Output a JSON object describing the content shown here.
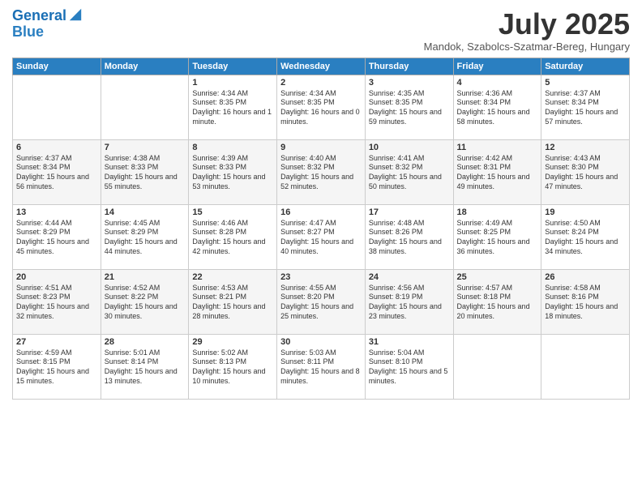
{
  "logo": {
    "line1": "General",
    "line2": "Blue"
  },
  "title": "July 2025",
  "location": "Mandok, Szabolcs-Szatmar-Bereg, Hungary",
  "weekdays": [
    "Sunday",
    "Monday",
    "Tuesday",
    "Wednesday",
    "Thursday",
    "Friday",
    "Saturday"
  ],
  "weeks": [
    [
      {
        "day": "",
        "sunrise": "",
        "sunset": "",
        "daylight": ""
      },
      {
        "day": "",
        "sunrise": "",
        "sunset": "",
        "daylight": ""
      },
      {
        "day": "1",
        "sunrise": "Sunrise: 4:34 AM",
        "sunset": "Sunset: 8:35 PM",
        "daylight": "Daylight: 16 hours and 1 minute."
      },
      {
        "day": "2",
        "sunrise": "Sunrise: 4:34 AM",
        "sunset": "Sunset: 8:35 PM",
        "daylight": "Daylight: 16 hours and 0 minutes."
      },
      {
        "day": "3",
        "sunrise": "Sunrise: 4:35 AM",
        "sunset": "Sunset: 8:35 PM",
        "daylight": "Daylight: 15 hours and 59 minutes."
      },
      {
        "day": "4",
        "sunrise": "Sunrise: 4:36 AM",
        "sunset": "Sunset: 8:34 PM",
        "daylight": "Daylight: 15 hours and 58 minutes."
      },
      {
        "day": "5",
        "sunrise": "Sunrise: 4:37 AM",
        "sunset": "Sunset: 8:34 PM",
        "daylight": "Daylight: 15 hours and 57 minutes."
      }
    ],
    [
      {
        "day": "6",
        "sunrise": "Sunrise: 4:37 AM",
        "sunset": "Sunset: 8:34 PM",
        "daylight": "Daylight: 15 hours and 56 minutes."
      },
      {
        "day": "7",
        "sunrise": "Sunrise: 4:38 AM",
        "sunset": "Sunset: 8:33 PM",
        "daylight": "Daylight: 15 hours and 55 minutes."
      },
      {
        "day": "8",
        "sunrise": "Sunrise: 4:39 AM",
        "sunset": "Sunset: 8:33 PM",
        "daylight": "Daylight: 15 hours and 53 minutes."
      },
      {
        "day": "9",
        "sunrise": "Sunrise: 4:40 AM",
        "sunset": "Sunset: 8:32 PM",
        "daylight": "Daylight: 15 hours and 52 minutes."
      },
      {
        "day": "10",
        "sunrise": "Sunrise: 4:41 AM",
        "sunset": "Sunset: 8:32 PM",
        "daylight": "Daylight: 15 hours and 50 minutes."
      },
      {
        "day": "11",
        "sunrise": "Sunrise: 4:42 AM",
        "sunset": "Sunset: 8:31 PM",
        "daylight": "Daylight: 15 hours and 49 minutes."
      },
      {
        "day": "12",
        "sunrise": "Sunrise: 4:43 AM",
        "sunset": "Sunset: 8:30 PM",
        "daylight": "Daylight: 15 hours and 47 minutes."
      }
    ],
    [
      {
        "day": "13",
        "sunrise": "Sunrise: 4:44 AM",
        "sunset": "Sunset: 8:29 PM",
        "daylight": "Daylight: 15 hours and 45 minutes."
      },
      {
        "day": "14",
        "sunrise": "Sunrise: 4:45 AM",
        "sunset": "Sunset: 8:29 PM",
        "daylight": "Daylight: 15 hours and 44 minutes."
      },
      {
        "day": "15",
        "sunrise": "Sunrise: 4:46 AM",
        "sunset": "Sunset: 8:28 PM",
        "daylight": "Daylight: 15 hours and 42 minutes."
      },
      {
        "day": "16",
        "sunrise": "Sunrise: 4:47 AM",
        "sunset": "Sunset: 8:27 PM",
        "daylight": "Daylight: 15 hours and 40 minutes."
      },
      {
        "day": "17",
        "sunrise": "Sunrise: 4:48 AM",
        "sunset": "Sunset: 8:26 PM",
        "daylight": "Daylight: 15 hours and 38 minutes."
      },
      {
        "day": "18",
        "sunrise": "Sunrise: 4:49 AM",
        "sunset": "Sunset: 8:25 PM",
        "daylight": "Daylight: 15 hours and 36 minutes."
      },
      {
        "day": "19",
        "sunrise": "Sunrise: 4:50 AM",
        "sunset": "Sunset: 8:24 PM",
        "daylight": "Daylight: 15 hours and 34 minutes."
      }
    ],
    [
      {
        "day": "20",
        "sunrise": "Sunrise: 4:51 AM",
        "sunset": "Sunset: 8:23 PM",
        "daylight": "Daylight: 15 hours and 32 minutes."
      },
      {
        "day": "21",
        "sunrise": "Sunrise: 4:52 AM",
        "sunset": "Sunset: 8:22 PM",
        "daylight": "Daylight: 15 hours and 30 minutes."
      },
      {
        "day": "22",
        "sunrise": "Sunrise: 4:53 AM",
        "sunset": "Sunset: 8:21 PM",
        "daylight": "Daylight: 15 hours and 28 minutes."
      },
      {
        "day": "23",
        "sunrise": "Sunrise: 4:55 AM",
        "sunset": "Sunset: 8:20 PM",
        "daylight": "Daylight: 15 hours and 25 minutes."
      },
      {
        "day": "24",
        "sunrise": "Sunrise: 4:56 AM",
        "sunset": "Sunset: 8:19 PM",
        "daylight": "Daylight: 15 hours and 23 minutes."
      },
      {
        "day": "25",
        "sunrise": "Sunrise: 4:57 AM",
        "sunset": "Sunset: 8:18 PM",
        "daylight": "Daylight: 15 hours and 20 minutes."
      },
      {
        "day": "26",
        "sunrise": "Sunrise: 4:58 AM",
        "sunset": "Sunset: 8:16 PM",
        "daylight": "Daylight: 15 hours and 18 minutes."
      }
    ],
    [
      {
        "day": "27",
        "sunrise": "Sunrise: 4:59 AM",
        "sunset": "Sunset: 8:15 PM",
        "daylight": "Daylight: 15 hours and 15 minutes."
      },
      {
        "day": "28",
        "sunrise": "Sunrise: 5:01 AM",
        "sunset": "Sunset: 8:14 PM",
        "daylight": "Daylight: 15 hours and 13 minutes."
      },
      {
        "day": "29",
        "sunrise": "Sunrise: 5:02 AM",
        "sunset": "Sunset: 8:13 PM",
        "daylight": "Daylight: 15 hours and 10 minutes."
      },
      {
        "day": "30",
        "sunrise": "Sunrise: 5:03 AM",
        "sunset": "Sunset: 8:11 PM",
        "daylight": "Daylight: 15 hours and 8 minutes."
      },
      {
        "day": "31",
        "sunrise": "Sunrise: 5:04 AM",
        "sunset": "Sunset: 8:10 PM",
        "daylight": "Daylight: 15 hours and 5 minutes."
      },
      {
        "day": "",
        "sunrise": "",
        "sunset": "",
        "daylight": ""
      },
      {
        "day": "",
        "sunrise": "",
        "sunset": "",
        "daylight": ""
      }
    ]
  ]
}
